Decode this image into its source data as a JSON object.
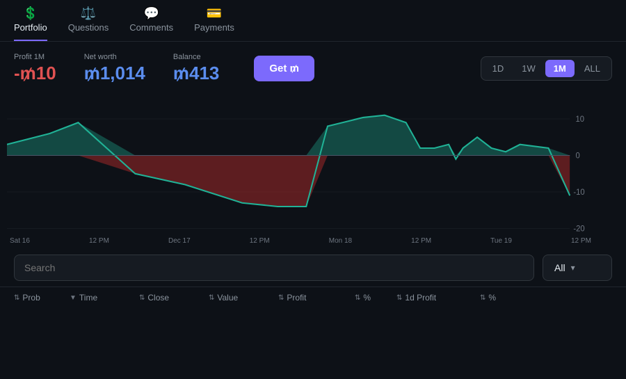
{
  "nav": {
    "tabs": [
      {
        "id": "portfolio",
        "label": "Portfolio",
        "icon": "💲",
        "active": true
      },
      {
        "id": "questions",
        "label": "Questions",
        "icon": "⚖️",
        "active": false
      },
      {
        "id": "comments",
        "label": "Comments",
        "icon": "💬",
        "active": false
      },
      {
        "id": "payments",
        "label": "Payments",
        "icon": "💳",
        "active": false
      }
    ]
  },
  "stats": {
    "profit1m_label": "Profit 1M",
    "profit1m_value": "-₥10",
    "networth_label": "Net worth",
    "networth_value": "₥1,014",
    "balance_label": "Balance",
    "balance_value": "₥413",
    "get_btn_label": "Get ₥"
  },
  "timefilters": {
    "options": [
      "1D",
      "1W",
      "1M",
      "ALL"
    ],
    "active": "1M"
  },
  "xlabels": [
    "Sat 16",
    "12 PM",
    "Dec 17",
    "12 PM",
    "Mon 18",
    "12 PM",
    "Tue 19",
    "12 PM"
  ],
  "ylabels": [
    "10",
    "0",
    "-10",
    "-20"
  ],
  "search": {
    "placeholder": "Search"
  },
  "filter": {
    "label": "All"
  },
  "table": {
    "columns": [
      {
        "id": "prob",
        "label": "Prob",
        "sort": "both"
      },
      {
        "id": "time",
        "label": "Time",
        "sort": "down"
      },
      {
        "id": "close",
        "label": "Close",
        "sort": "both"
      },
      {
        "id": "value",
        "label": "Value",
        "sort": "both"
      },
      {
        "id": "profit",
        "label": "Profit",
        "sort": "both"
      },
      {
        "id": "percent",
        "label": "%",
        "sort": "both"
      },
      {
        "id": "1dprofit",
        "label": "1d Profit",
        "sort": "both"
      },
      {
        "id": "pct2",
        "label": "%",
        "sort": "both"
      }
    ]
  }
}
